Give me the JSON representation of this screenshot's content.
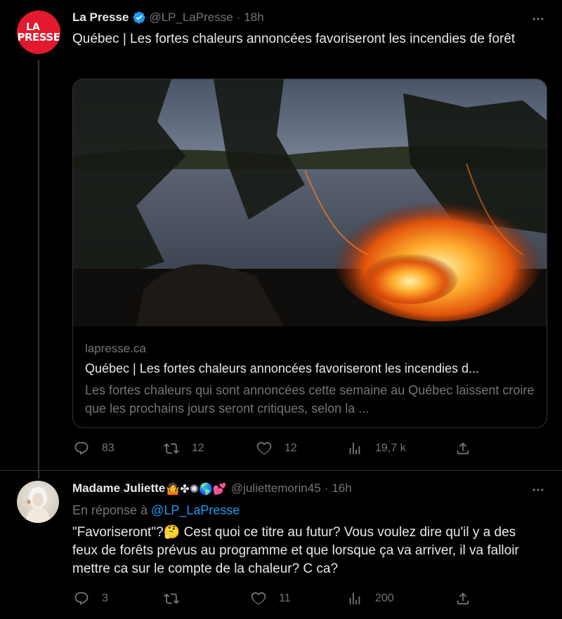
{
  "tweet1": {
    "avatar_line1": "LA",
    "avatar_line2": "PRESSE",
    "name": "La Presse",
    "handle": "@LP_LaPresse",
    "separator": "·",
    "time": "18h",
    "text": "Québec | Les fortes chaleurs annoncées favoriseront les incendies de forêt",
    "card": {
      "domain": "lapresse.ca",
      "title": "Québec | Les fortes chaleurs annoncées favoriseront les incendies d...",
      "description": "Les fortes chaleurs qui sont annoncées cette semaine au Québec laissent croire que les prochains jours seront critiques, selon la ..."
    },
    "stats": {
      "replies": "83",
      "retweets": "12",
      "likes": "12",
      "views": "19,7 k"
    }
  },
  "tweet2": {
    "name": "Madame Juliette",
    "emojis": "🤷✤✺🌎💕",
    "handle": "@juliettemorin45",
    "separator": "·",
    "time": "16h",
    "reply_prefix": "En réponse à",
    "reply_mention": "@LP_LaPresse",
    "text": "\"Favoriseront\"?🤔 Cest quoi ce titre au futur? Vous voulez dire qu'il y a des feux de forêts prévus au programme et que lorsque ça va arriver, il va falloir mettre ca sur le compte de la chaleur? C ca?",
    "stats": {
      "replies": "3",
      "retweets": "",
      "likes": "11",
      "views": "200"
    }
  },
  "colors": {
    "background": "#000000",
    "text": "#e7e9ea",
    "muted": "#71767b",
    "link": "#1d9bf0",
    "verified": "#1d9bf0",
    "brand_red": "#e3192d"
  },
  "icons": [
    "verified-badge-icon",
    "more-icon",
    "reply-icon",
    "retweet-icon",
    "like-icon",
    "views-icon",
    "share-icon"
  ]
}
